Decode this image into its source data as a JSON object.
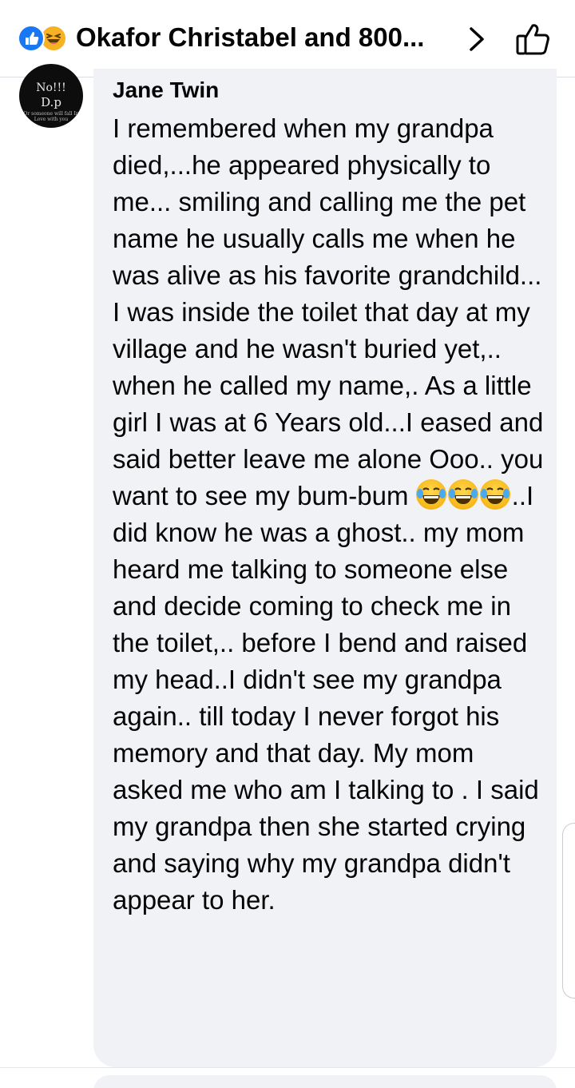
{
  "header": {
    "title": "Okafor Christabel and 800...",
    "reaction_icons": [
      "like-icon",
      "haha-icon"
    ],
    "chevron_icon": "chevron-right-icon",
    "like_button_icon": "thumbs-up-outline-icon"
  },
  "comment": {
    "avatar": {
      "line1": "No!!!",
      "line2": "D.p",
      "line3": "Or someone will fall In Love with you"
    },
    "author": "Jane Twin",
    "text_before_emoji": "I remembered when my grandpa died,...he appeared physically to me... smiling and calling me the pet name he usually calls me when he was alive as his favorite grandchild... I was inside the toilet that day at my village and he wasn't buried yet,.. when he called my name,. As a little girl I was at 6 Years old...I eased and said better leave me alone Ooo..  you want to see my bum-bum ",
    "emoji_icon": "tears-of-joy-emoji",
    "text_after_emoji": "..I did know he was a ghost..  my mom heard me talking to someone else and decide coming to check me in the toilet,.. before I bend and raised my head..I didn't see my grandpa again..  till today I never forgot his memory and that day. My mom asked me who am I talking to . I said my grandpa then she started crying and saying why my grandpa didn't appear to her."
  },
  "colors": {
    "like_blue": "#1877f2",
    "haha_yellow": "#f7b125",
    "bubble_gray": "#f0f2f5",
    "text_dark": "#050505"
  }
}
